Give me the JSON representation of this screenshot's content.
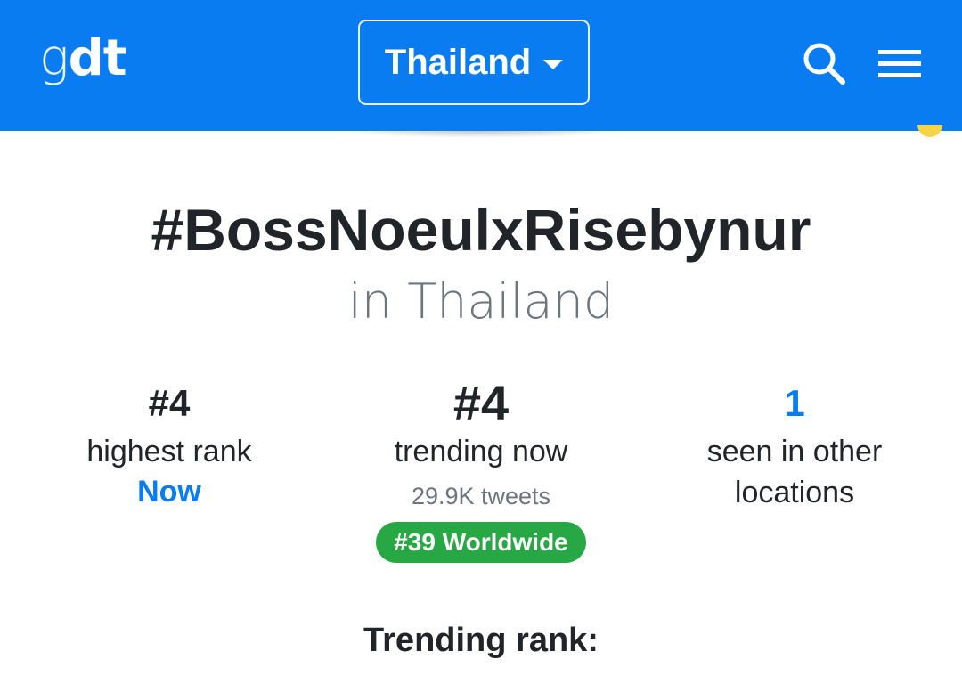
{
  "header": {
    "logo_part1": "g",
    "logo_part2": "dt",
    "country": "Thailand",
    "search_icon": "search-icon",
    "menu_icon": "hamburger-menu-icon",
    "brand_color": "#0a7cf2"
  },
  "trend": {
    "title": "#BossNoeulxRisebynur",
    "location": "in Thailand"
  },
  "stats": {
    "highest_rank": {
      "value": "#4",
      "label": "highest rank",
      "when": "Now"
    },
    "trending_now": {
      "value": "#4",
      "label": "trending now",
      "tweets": "29.9K tweets",
      "worldwide": "#39 Worldwide"
    },
    "other_locations": {
      "value": "1",
      "label_line1": "seen in other",
      "label_line2": "locations"
    }
  },
  "sections": {
    "trending_rank_heading": "Trending rank:"
  },
  "colors": {
    "accent": "#0a7cf2",
    "badge_green": "#28a745",
    "text_dark": "#212529",
    "text_muted": "#6c757d"
  }
}
